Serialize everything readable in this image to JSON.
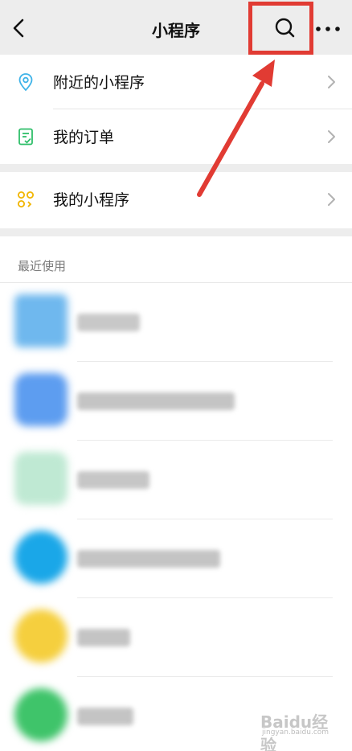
{
  "header": {
    "title": "小程序",
    "back_icon": "chevron-left-icon",
    "search_icon": "search-icon",
    "more_icon": "more-dots-icon"
  },
  "menu": [
    {
      "label": "附近的小程序",
      "icon": "location-pin-icon",
      "icon_color": "#3fb3e8"
    },
    {
      "label": "我的订单",
      "icon": "order-list-icon",
      "icon_color": "#2fbf6a"
    },
    {
      "label": "我的小程序",
      "icon": "mini-program-icon",
      "icon_color": "#f1b500"
    }
  ],
  "recent": {
    "label": "最近使用",
    "apps": [
      {
        "icon_color": "#6fb8ee",
        "name_blurred": true
      },
      {
        "icon_color": "#5d9df0",
        "name_blurred": true
      },
      {
        "icon_color": "#7bd6a8",
        "name_blurred": true
      },
      {
        "icon_color": "#1aa7e8",
        "name_blurred": true
      },
      {
        "icon_color": "#f5cf3e",
        "name_blurred": true
      },
      {
        "icon_color": "#3fc46a",
        "name_blurred": true
      }
    ]
  },
  "annotation": {
    "highlight_color": "#e13b33"
  },
  "watermark": {
    "text": "Baidu经验",
    "sub": "jingyan.baidu.com"
  }
}
